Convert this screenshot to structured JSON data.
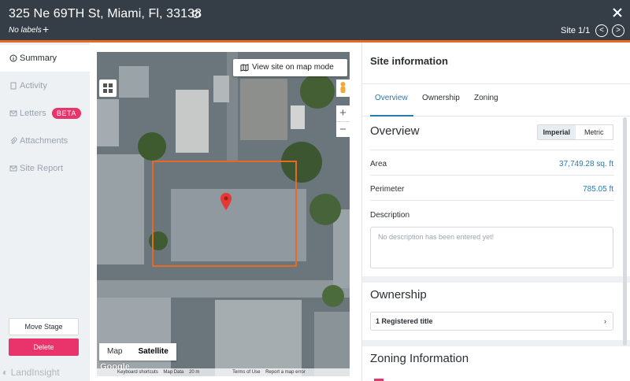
{
  "header": {
    "title": "325 Ne 69TH St, Miami, Fl, 33138",
    "labels_text": "No labels",
    "add_label": "+",
    "site_count": "Site 1/1",
    "prev": "<",
    "next": ">"
  },
  "sidebar": {
    "items": [
      {
        "label": "Summary",
        "icon": "info-circle-icon"
      },
      {
        "label": "Activity",
        "icon": "document-icon"
      },
      {
        "label": "Letters",
        "icon": "envelope-icon",
        "badge": "BETA"
      },
      {
        "label": "Attachments",
        "icon": "paperclip-icon"
      },
      {
        "label": "Site Report",
        "icon": "envelope-icon"
      }
    ],
    "move_stage": "Move Stage",
    "delete": "Delete",
    "logo": "LandInsight"
  },
  "map": {
    "view_button": "View site on map mode",
    "zoom_in": "+",
    "zoom_out": "−",
    "types": [
      "Map",
      "Satellite"
    ],
    "selected_type": "Satellite",
    "google": "Google",
    "attribution": [
      "Keyboard shortcuts",
      "Map Data",
      "20 m",
      "Terms of Use",
      "Report a map error"
    ]
  },
  "panel": {
    "title": "Site information",
    "tabs": [
      "Overview",
      "Ownership",
      "Zoning"
    ],
    "active_tab": "Overview",
    "overview": {
      "heading": "Overview",
      "units": [
        "Imperial",
        "Metric"
      ],
      "selected_unit": "Imperial",
      "area_label": "Area",
      "area_value": "37,749.28 sq. ft",
      "perimeter_label": "Perimeter",
      "perimeter_value": "785.05 ft",
      "description_label": "Description",
      "description_placeholder": "No description has been entered yet!"
    },
    "ownership": {
      "heading": "Ownership",
      "registered": "1 Registered title",
      "chevron": "›"
    },
    "zoning": {
      "heading": "Zoning Information"
    }
  },
  "colors": {
    "header_bg": "#353d46",
    "accent": "#e8691f",
    "delete": "#e8336b",
    "link": "#2a7ab0",
    "sidebar_bg": "#eef1f4"
  }
}
